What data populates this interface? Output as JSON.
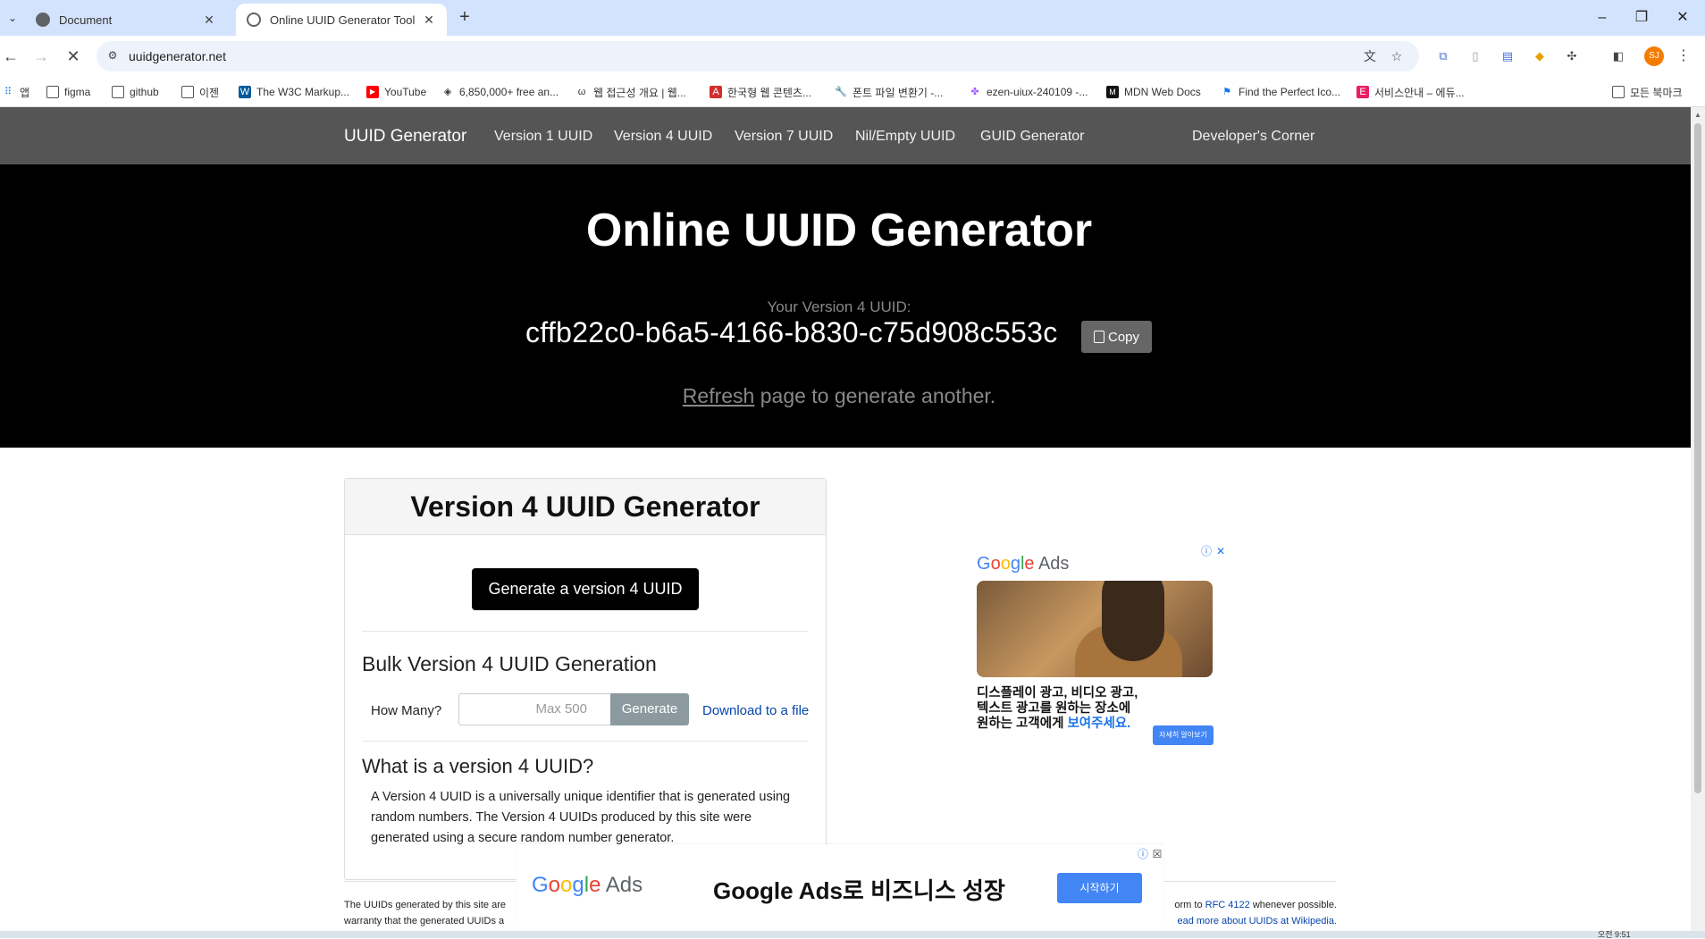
{
  "browser": {
    "tabs": [
      {
        "title": "Document"
      },
      {
        "title": "Online UUID Generator Tool"
      }
    ],
    "url": "uuidgenerator.net",
    "profile_initials": "SJ",
    "bookmarks": [
      {
        "label": "앱",
        "icon": "apps-grid-icon"
      },
      {
        "label": "figma",
        "icon": "folder-icon"
      },
      {
        "label": "github",
        "icon": "folder-icon"
      },
      {
        "label": "이젠",
        "icon": "folder-icon"
      },
      {
        "label": "The W3C Markup...",
        "icon": "w3c-icon"
      },
      {
        "label": "YouTube",
        "icon": "youtube-icon"
      },
      {
        "label": "6,850,000+ free an...",
        "icon": "site-icon"
      },
      {
        "label": "웹 접근성 개요 | 웹...",
        "icon": "site-icon"
      },
      {
        "label": "한국형 웹 콘텐츠...",
        "icon": "pdf-icon"
      },
      {
        "label": "폰트 파일 변환기 -...",
        "icon": "wrench-icon"
      },
      {
        "label": "ezen-uiux-240109 -...",
        "icon": "figma-icon"
      },
      {
        "label": "MDN Web Docs",
        "icon": "mdn-icon"
      },
      {
        "label": "Find the Perfect Ico...",
        "icon": "flag-icon"
      },
      {
        "label": "서비스안내 – 에듀...",
        "icon": "e-icon"
      },
      {
        "label": "모든 북마크",
        "icon": "folder-icon"
      }
    ]
  },
  "site_nav": {
    "brand": "UUID Generator",
    "links": [
      "Version 1 UUID",
      "Version 4 UUID",
      "Version 7 UUID",
      "Nil/Empty UUID",
      "GUID Generator",
      "Developer's Corner"
    ]
  },
  "hero": {
    "title": "Online UUID Generator",
    "uuid_label": "Your Version 4 UUID:",
    "uuid_value": "cffb22c0-b6a5-4166-b830-c75d908c553c",
    "copy_label": "Copy",
    "refresh_link": "Refresh",
    "refresh_rest": " page to generate another."
  },
  "card": {
    "title": "Version 4 UUID Generator",
    "generate_label": "Generate a version 4 UUID",
    "bulk_title": "Bulk Version 4 UUID Generation",
    "how_many_label": "How Many?",
    "count_placeholder": "Max 500",
    "bulk_generate_label": "Generate",
    "download_label": "Download to a file",
    "what_title": "What is a version 4 UUID?",
    "what_body": "A Version 4 UUID is a universally unique identifier that is generated using random numbers. The Version 4 UUIDs produced by this site were generated using a secure random number generator."
  },
  "side_ad": {
    "brand_g": "G",
    "brand_o1": "o",
    "brand_o2": "o",
    "brand_g2": "g",
    "brand_l": "l",
    "brand_e": "e",
    "brand_ads": " Ads",
    "text_line1": "디스플레이 광고, 비디오 광고,",
    "text_line2": "텍스트 광고를 원하는 장소에",
    "text_line3a": "원하는 고객에게 ",
    "text_line3b": "보여주세요.",
    "cta": "자세히 알아보기"
  },
  "bottom_ad": {
    "title": "Google Ads로 비즈니스 성장",
    "cta": "시작하기"
  },
  "footer": {
    "left_line1": "The UUIDs generated by this site are",
    "left_line2": "warranty that the generated UUIDs a",
    "right_line1_a": "orm to ",
    "right_line1_link": "RFC 4122",
    "right_line1_b": " whenever possible.",
    "right_line2": "ead more about UUIDs at Wikipedia."
  },
  "system": {
    "clock": "오전 9:51"
  },
  "colors": {
    "nav_bg": "#555555",
    "hero_bg": "#000000",
    "link": "#0645ad",
    "google_blue": "#4285f4"
  }
}
